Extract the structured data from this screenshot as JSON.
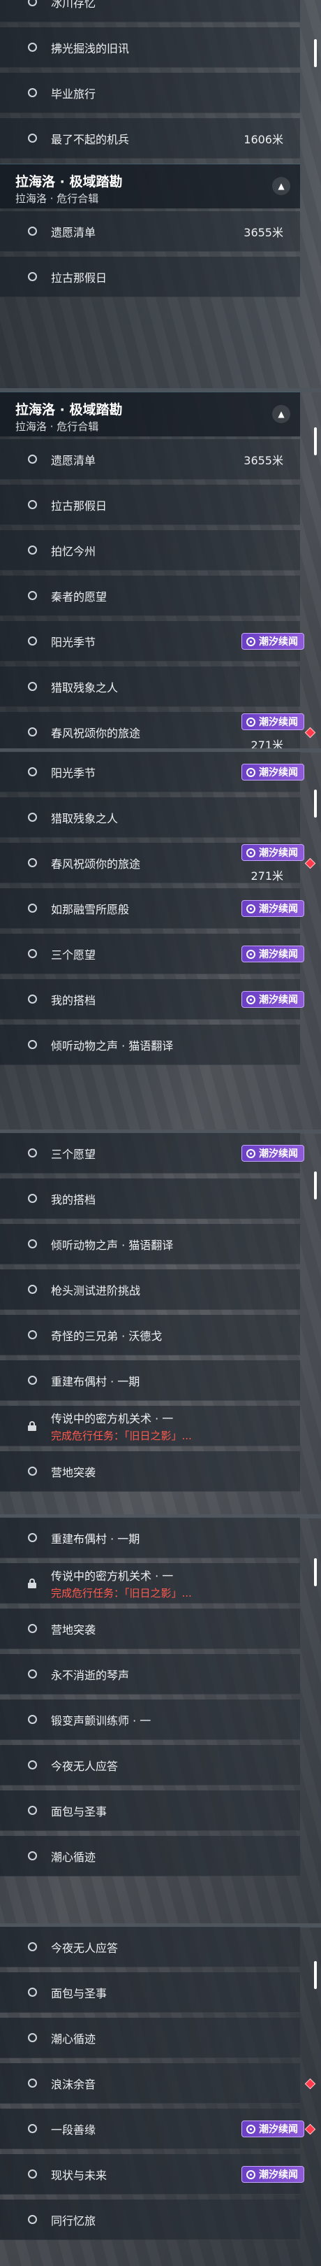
{
  "header": {
    "title": "拉海洛 · 极域踏勘",
    "subtitle": "拉海洛 · 危行合辑"
  },
  "tag_label": "潮汐续闻",
  "panels": [
    {
      "rows": [
        {
          "label": "冰川存忆"
        },
        {
          "label": "拂光掘浅的旧讯"
        },
        {
          "label": "毕业旅行"
        },
        {
          "label": "最了不起的机兵",
          "distance": "1606米"
        }
      ],
      "header": true,
      "rows_after": [
        {
          "label": "遗愿清单",
          "distance": "3655米"
        },
        {
          "label": "拉古那假日"
        }
      ]
    },
    {
      "header": true,
      "rows_after": [
        {
          "label": "遗愿清单",
          "distance": "3655米"
        },
        {
          "label": "拉古那假日"
        },
        {
          "label": "拍忆今州"
        },
        {
          "label": "秦者的愿望"
        },
        {
          "label": "阳光季节",
          "tag": true
        },
        {
          "label": "猎取残象之人"
        },
        {
          "label": "春风祝颂你的旅途",
          "tag": true,
          "diamond": true,
          "distance": "271米"
        }
      ]
    },
    {
      "rows": [
        {
          "label": "阳光季节",
          "tag": true
        },
        {
          "label": "猎取残象之人"
        },
        {
          "label": "春风祝颂你的旅途",
          "tag": true,
          "diamond": true,
          "distance": "271米"
        },
        {
          "label": "如那融雪所愿般",
          "tag": true
        },
        {
          "label": "三个愿望",
          "tag": true
        },
        {
          "label": "我的搭档",
          "tag": true
        },
        {
          "label": "倾听动物之声 · 猫语翻译"
        }
      ]
    },
    {
      "rows": [
        {
          "label": "三个愿望",
          "tag": true
        },
        {
          "label": "我的搭档"
        },
        {
          "label": "倾听动物之声 · 猫语翻译"
        },
        {
          "label": "枪头测试进阶挑战"
        },
        {
          "label": "奇怪的三兄弟 · 沃德戈"
        },
        {
          "label": "重建布偶村 · 一期"
        },
        {
          "label": "传说中的密方机关术 · 一",
          "locked": true,
          "sub": "完成危行任务：「旧日之影」..."
        },
        {
          "label": "营地突袭"
        }
      ]
    },
    {
      "rows": [
        {
          "label": "重建布偶村 · 一期"
        },
        {
          "label": "传说中的密方机关术 · 一",
          "locked": true,
          "sub": "完成危行任务：「旧日之影」..."
        },
        {
          "label": "营地突袭"
        },
        {
          "label": "永不消逝的琴声"
        },
        {
          "label": "锻变声颤训练师 · 一"
        },
        {
          "label": "今夜无人应答"
        },
        {
          "label": "面包与圣事"
        },
        {
          "label": "潮心循迹"
        }
      ]
    },
    {
      "rows": [
        {
          "label": "今夜无人应答"
        },
        {
          "label": "面包与圣事"
        },
        {
          "label": "潮心循迹"
        },
        {
          "label": "浪沫余音",
          "diamond": true
        },
        {
          "label": "一段善缘",
          "tag": true,
          "diamond": true
        },
        {
          "label": "现状与未来",
          "tag": true
        },
        {
          "label": "同行忆旅"
        }
      ]
    }
  ]
}
